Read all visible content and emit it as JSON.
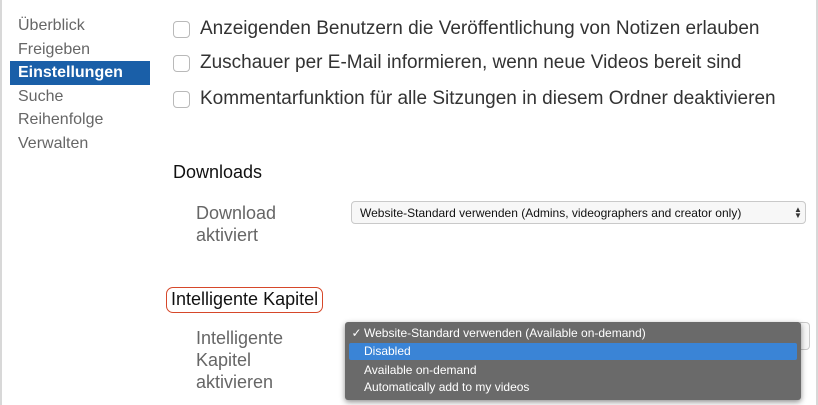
{
  "sidebar": {
    "items": [
      {
        "label": "Überblick"
      },
      {
        "label": "Freigeben"
      },
      {
        "label": "Einstellungen",
        "active": true
      },
      {
        "label": "Suche"
      },
      {
        "label": "Reihenfolge"
      },
      {
        "label": "Verwalten"
      }
    ]
  },
  "settings": {
    "checkboxes": [
      {
        "label": "Anzeigenden Benutzern die Veröffentlichung von Notizen erlauben",
        "checked": false
      },
      {
        "label": "Zuschauer per E-Mail informieren, wenn neue Videos bereit sind",
        "checked": false
      },
      {
        "label": "Kommentarfunktion für alle Sitzungen in diesem Ordner deaktivieren",
        "checked": false
      }
    ]
  },
  "downloads": {
    "title": "Downloads",
    "field_label_line1": "Download",
    "field_label_line2": "aktiviert",
    "select_value": "Website-Standard verwenden (Admins, videographers and creator only)"
  },
  "smart_chapters": {
    "title": "Intelligente Kapitel",
    "field_label_line1": "Intelligente",
    "field_label_line2": "Kapitel",
    "field_label_line3": "aktivieren",
    "dropdown_options": [
      {
        "label": "Website-Standard verwenden (Available on-demand)",
        "check": "✓"
      },
      {
        "label": "Disabled",
        "check": ""
      },
      {
        "label": "Available on-demand",
        "check": ""
      },
      {
        "label": "Automatically add to my videos",
        "check": ""
      }
    ]
  },
  "colors": {
    "sidebar_active": "#1a5fa8",
    "highlight_border": "#d6482a",
    "dropdown_bg": "#6a6a6a",
    "dropdown_hover": "#3a84d6"
  }
}
